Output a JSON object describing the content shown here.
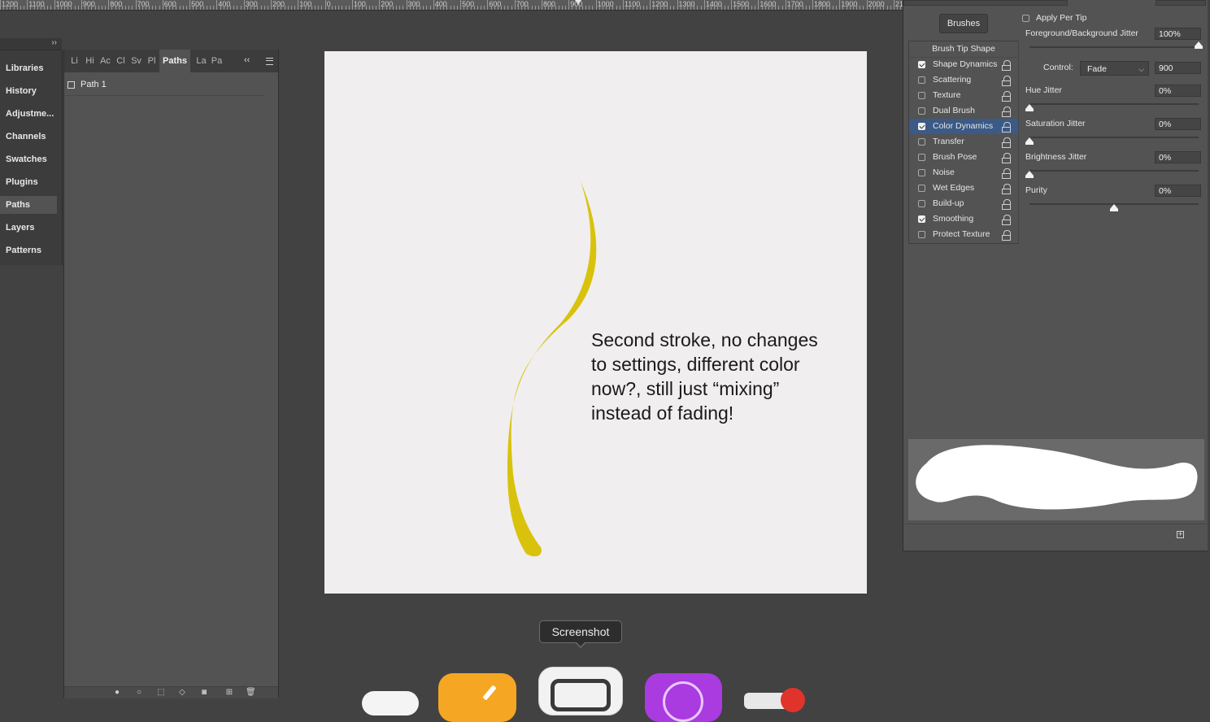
{
  "ruler": {
    "labels": [
      "1200",
      "1100",
      "1000",
      "900",
      "800",
      "700",
      "600",
      "500",
      "400",
      "300",
      "200",
      "100",
      "0",
      "100",
      "200",
      "300",
      "400",
      "500",
      "600",
      "700",
      "800",
      "900",
      "1000",
      "1100",
      "1200",
      "1300",
      "1400",
      "1500",
      "1600",
      "1700",
      "1800",
      "1900",
      "2000",
      "21"
    ]
  },
  "dock": {
    "expand_glyph": "››",
    "items": [
      {
        "label": "Libraries",
        "active": false
      },
      {
        "label": "History",
        "active": false
      },
      {
        "label": "Adjustme...",
        "active": false
      },
      {
        "label": "Channels",
        "active": false
      },
      {
        "label": "Swatches",
        "active": false
      },
      {
        "label": "Plugins",
        "active": false
      },
      {
        "label": "Paths",
        "active": true
      },
      {
        "label": "Layers",
        "active": false
      },
      {
        "label": "Patterns",
        "active": false
      }
    ]
  },
  "paths_panel": {
    "tabs": [
      {
        "label": "Li",
        "active": false
      },
      {
        "label": "Hi",
        "active": false
      },
      {
        "label": "Ac",
        "active": false
      },
      {
        "label": "Cl",
        "active": false
      },
      {
        "label": "Sv",
        "active": false
      },
      {
        "label": "Pl",
        "active": false
      },
      {
        "label": "Paths",
        "active": true
      },
      {
        "label": "La",
        "active": false
      },
      {
        "label": "Pa",
        "active": false
      }
    ],
    "collapse_glyph": "‹‹",
    "path_name": "Path 1"
  },
  "canvas": {
    "background": "#f0eeee",
    "stroke_color": "#d9c20c",
    "note": "Second stroke, no changes\nto settings, different color\nnow?, still just “mixing”\ninstead of fading!"
  },
  "brush_settings": {
    "brushes_button": "Brushes",
    "apply_per_tip": "Apply Per Tip",
    "tip_shape": "Brush Tip Shape",
    "options": [
      {
        "label": "Shape Dynamics",
        "checked": true,
        "active": false
      },
      {
        "label": "Scattering",
        "checked": false,
        "active": false
      },
      {
        "label": "Texture",
        "checked": false,
        "active": false
      },
      {
        "label": "Dual Brush",
        "checked": false,
        "active": false
      },
      {
        "label": "Color Dynamics",
        "checked": true,
        "active": true
      },
      {
        "label": "Transfer",
        "checked": false,
        "active": false
      },
      {
        "label": "Brush Pose",
        "checked": false,
        "active": false
      },
      {
        "label": "Noise",
        "checked": false,
        "active": false
      },
      {
        "label": "Wet Edges",
        "checked": false,
        "active": false
      },
      {
        "label": "Build-up",
        "checked": false,
        "active": false
      },
      {
        "label": "Smoothing",
        "checked": true,
        "active": false
      },
      {
        "label": "Protect Texture",
        "checked": false,
        "active": false
      }
    ],
    "fg_bg_jitter": {
      "label": "Foreground/Background Jitter",
      "value": "100%",
      "level": 1.0
    },
    "control": {
      "label": "Control:",
      "value": "Fade",
      "steps": "900"
    },
    "hue_jitter": {
      "label": "Hue Jitter",
      "value": "0%",
      "level": 0.0
    },
    "saturation_jitter": {
      "label": "Saturation Jitter",
      "value": "0%",
      "level": 0.0
    },
    "brightness_jitter": {
      "label": "Brightness Jitter",
      "value": "0%",
      "level": 0.0
    },
    "purity": {
      "label": "Purity",
      "value": "0%",
      "level": 0.5
    }
  },
  "tooltip": {
    "label": "Screenshot"
  },
  "accent_color": "#3b5a86"
}
